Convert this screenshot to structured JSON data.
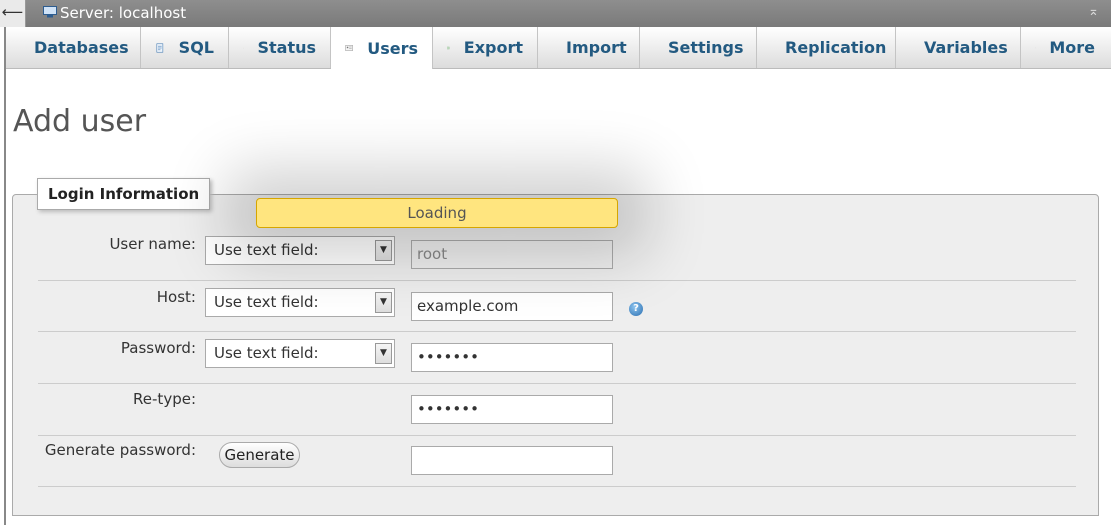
{
  "titlebar": {
    "back_glyph": "⟵",
    "title": "Server: localhost",
    "collapse_glyph": "⌅"
  },
  "tabs": [
    {
      "label": "Databases",
      "icon": "database-icon",
      "active": false
    },
    {
      "label": "SQL",
      "icon": "sql-icon",
      "active": false
    },
    {
      "label": "Status",
      "icon": "status-icon",
      "active": false
    },
    {
      "label": "Users",
      "icon": "users-icon",
      "active": true
    },
    {
      "label": "Export",
      "icon": "export-icon",
      "active": false
    },
    {
      "label": "Import",
      "icon": "import-icon",
      "active": false
    },
    {
      "label": "Settings",
      "icon": "settings-icon",
      "active": false
    },
    {
      "label": "Replication",
      "icon": "replication-icon",
      "active": false
    },
    {
      "label": "Variables",
      "icon": "variables-icon",
      "active": false
    },
    {
      "label": "More",
      "icon": "chevron-down-icon",
      "active": false
    }
  ],
  "page": {
    "title": "Add user"
  },
  "login": {
    "legend": "Login Information",
    "loading": "Loading",
    "username": {
      "label": "User name:",
      "select": "Use text field:",
      "value": "root"
    },
    "host": {
      "label": "Host:",
      "select": "Use text field:",
      "value": "example.com"
    },
    "password": {
      "label": "Password:",
      "select": "Use text field:",
      "value": "•••••••"
    },
    "retype": {
      "label": "Re-type:",
      "value": "•••••••"
    },
    "generate": {
      "label": "Generate password:",
      "button": "Generate",
      "value": ""
    }
  },
  "colors": {
    "tab_text": "#235a81",
    "loading_bg": "#ffe57f"
  }
}
